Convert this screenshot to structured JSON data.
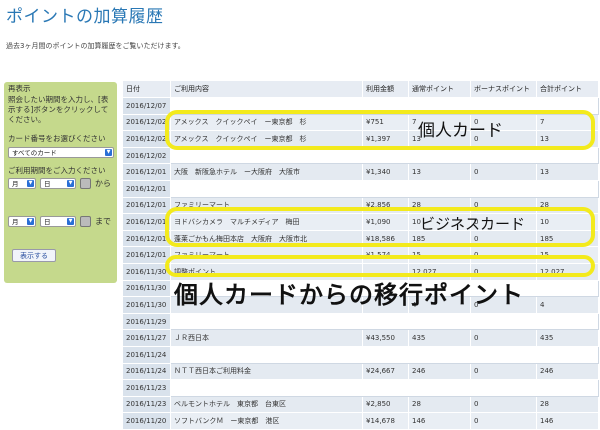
{
  "page": {
    "title": "ポイントの加算履歴",
    "subtitle": "過去3ヶ月間のポイントの加算履歴をご覧いただけます。"
  },
  "sidebar": {
    "heading": "再表示",
    "instruction": "照会したい期間を入力し、[表示する]ボタンをクリックしてください。",
    "card_label": "カード番号をお選びください",
    "card_select": "すべてのカード",
    "period_label": "ご利用期間をご入力ください",
    "from_month": "月",
    "from_day": "日",
    "from_suffix": "から",
    "to_month": "月",
    "to_day": "日",
    "to_suffix": "まで",
    "submit_label": "表示する"
  },
  "table": {
    "headers": [
      "日付",
      "ご利用内容",
      "利用金額",
      "通常ポイント",
      "ボーナスポイント",
      "合計ポイント"
    ],
    "rows": [
      {
        "date": "2016/12/07",
        "blank": true
      },
      {
        "date": "2016/12/02",
        "desc": "アメックス　クイックペイ　ー東京都　杉",
        "amount": "¥751",
        "normal": "7",
        "bonus": "0",
        "total": "7"
      },
      {
        "date": "2016/12/02",
        "desc": "アメックス　クイックペイ　ー東京都　杉",
        "amount": "¥1,397",
        "normal": "13",
        "bonus": "0",
        "total": "13"
      },
      {
        "date": "2016/12/02",
        "blank": true
      },
      {
        "date": "2016/12/01",
        "desc": "大阪　新阪急ホテル　ー大阪府　大阪市",
        "amount": "¥1,340",
        "normal": "13",
        "bonus": "0",
        "total": "13"
      },
      {
        "date": "2016/12/01",
        "blank": true
      },
      {
        "date": "2016/12/01",
        "desc": "ファミリーマート",
        "amount": "¥2,856",
        "normal": "28",
        "bonus": "0",
        "total": "28"
      },
      {
        "date": "2016/12/01",
        "desc": "ヨドバシカメラ　マルチメディア　梅田",
        "amount": "¥1,090",
        "normal": "10",
        "bonus": "0",
        "total": "10"
      },
      {
        "date": "2016/12/01",
        "desc": "蓬莱ごかもん梅田本店　大阪府　大阪市北",
        "amount": "¥18,586",
        "normal": "185",
        "bonus": "0",
        "total": "185"
      },
      {
        "date": "2016/12/01",
        "desc": "ファミリーマート",
        "amount": "¥1,574",
        "normal": "15",
        "bonus": "0",
        "total": "15"
      },
      {
        "date": "2016/11/30",
        "desc": "調整ポイント",
        "amount": "",
        "normal": "12,027",
        "bonus": "0",
        "total": "12,027"
      },
      {
        "date": "2016/11/30",
        "blank": true
      },
      {
        "date": "2016/11/30",
        "desc": "",
        "amount": "",
        "normal": "4",
        "bonus": "0",
        "total": "4"
      },
      {
        "date": "2016/11/29",
        "blank": true
      },
      {
        "date": "2016/11/27",
        "desc": "ＪＲ西日本",
        "amount": "¥43,550",
        "normal": "435",
        "bonus": "0",
        "total": "435"
      },
      {
        "date": "2016/11/24",
        "blank": true
      },
      {
        "date": "2016/11/24",
        "desc": "ＮＴＴ西日本ご利用料金",
        "amount": "¥24,667",
        "normal": "246",
        "bonus": "0",
        "total": "246"
      },
      {
        "date": "2016/11/23",
        "blank": true
      },
      {
        "date": "2016/11/23",
        "desc": "ベルモントホテル　東京都　台東区",
        "amount": "¥2,850",
        "normal": "28",
        "bonus": "0",
        "total": "28"
      },
      {
        "date": "2016/11/20",
        "desc": "ソフトバンクＭ　ー東京都　港区",
        "amount": "¥14,678",
        "normal": "146",
        "bonus": "0",
        "total": "146"
      }
    ]
  },
  "annotations": {
    "personal_card": "個人カード",
    "business_card": "ビジネスカード",
    "transfer_points": "個人カードからの移行ポイント",
    "highlight_color": "#f3ea1c"
  }
}
